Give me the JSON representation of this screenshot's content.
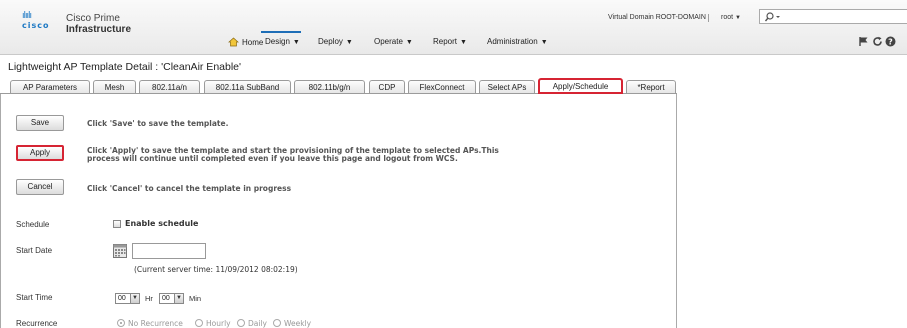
{
  "header": {
    "logo_text": "cisco",
    "product_line1": "Cisco Prime",
    "product_line2": "Infrastructure",
    "virtual_domain": "Virtual Domain ROOT-DOMAIN",
    "separator": "|",
    "user": "root",
    "search_placeholder": ""
  },
  "nav": {
    "home": "Home",
    "design": "Design",
    "deploy": "Deploy",
    "operate": "Operate",
    "report": "Report",
    "administration": "Administration",
    "arrow": "▼"
  },
  "page": {
    "title": "Lightweight AP Template Detail : 'CleanAir Enable'"
  },
  "tabs": [
    {
      "label": "AP Parameters"
    },
    {
      "label": "Mesh"
    },
    {
      "label": "802.11a/n"
    },
    {
      "label": "802.11a SubBand"
    },
    {
      "label": "802.11b/g/n"
    },
    {
      "label": "CDP"
    },
    {
      "label": "FlexConnect"
    },
    {
      "label": "Select APs"
    },
    {
      "label": "Apply/Schedule"
    },
    {
      "label": "*Report"
    }
  ],
  "actions": {
    "save_label": "Save",
    "save_desc": "Click 'Save' to save the template.",
    "apply_label": "Apply",
    "apply_desc_1": "Click 'Apply' to save the template and start the provisioning of the template to selected APs.This",
    "apply_desc_2": "process will continue until completed even if you leave this page and logout from WCS.",
    "cancel_label": "Cancel",
    "cancel_desc": "Click 'Cancel' to cancel the template in progress"
  },
  "schedule": {
    "label": "Schedule",
    "enable_label": "Enable schedule",
    "start_date_label": "Start Date",
    "start_date_value": "",
    "server_time": "(Current server time: 11/09/2012 08:02:19)",
    "start_time_label": "Start Time",
    "hour_value": "00",
    "hour_unit": "Hr",
    "min_value": "00",
    "min_unit": "Min",
    "recurrence_label": "Recurrence",
    "recurrence_options": [
      "No Recurrence",
      "Hourly",
      "Daily",
      "Weekly"
    ],
    "recurrence_selected": "No Recurrence"
  },
  "colors": {
    "highlight": "#d62433",
    "brand_blue": "#1e79c4"
  }
}
